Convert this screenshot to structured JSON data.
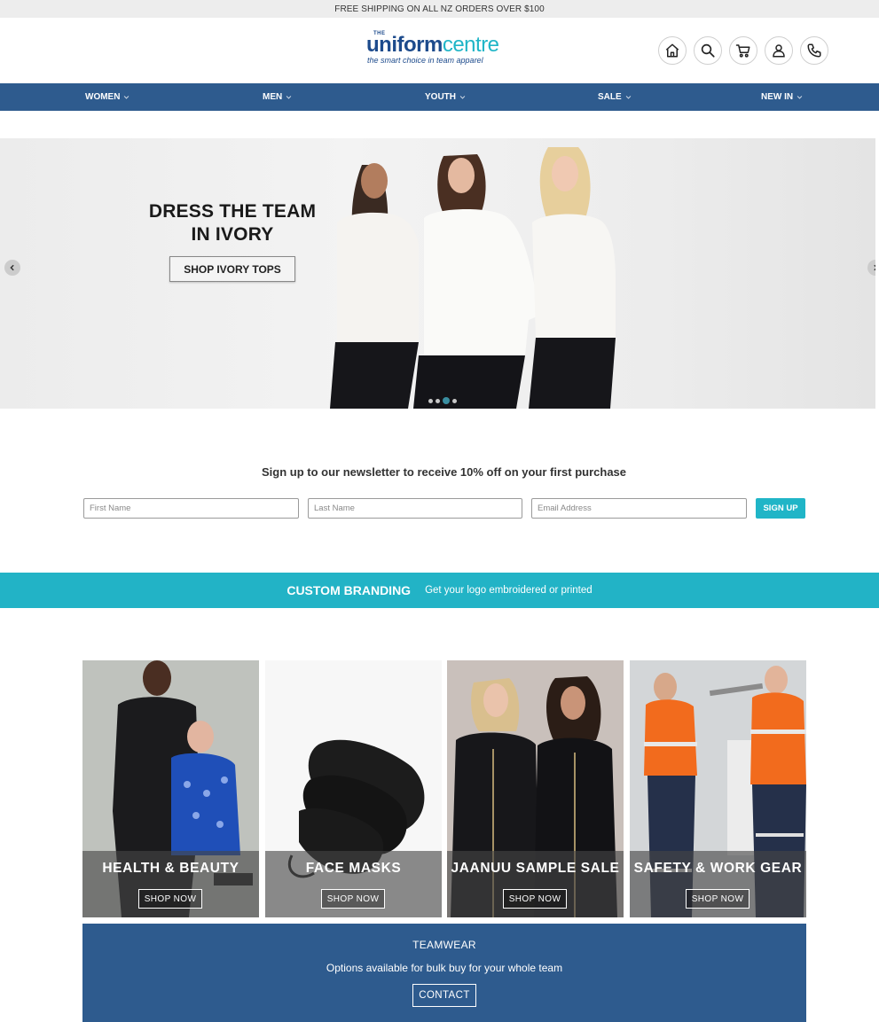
{
  "topbar": {
    "text": "FREE SHIPPING ON ALL NZ ORDERS OVER $100"
  },
  "logo": {
    "the": "THE",
    "brand_bold": "uniform",
    "brand_light": "centre",
    "tagline": "the smart choice in team apparel"
  },
  "header_icons": [
    "home-icon",
    "search-icon",
    "cart-icon",
    "user-icon",
    "phone-icon"
  ],
  "nav": [
    {
      "label": "WOMEN"
    },
    {
      "label": "MEN"
    },
    {
      "label": "YOUTH"
    },
    {
      "label": "SALE"
    },
    {
      "label": "NEW IN"
    }
  ],
  "hero": {
    "title_line1": "DRESS THE TEAM",
    "title_line2": "IN IVORY",
    "button": "SHOP IVORY TOPS",
    "slides_total": 4,
    "active_slide": 3
  },
  "newsletter": {
    "title": "Sign up to our newsletter to receive 10% off on your first purchase",
    "first_name_placeholder": "First Name",
    "last_name_placeholder": "Last Name",
    "email_placeholder": "Email Address",
    "button": "SIGN UP"
  },
  "branding": {
    "title": "CUSTOM BRANDING",
    "subtitle": "Get your logo embroidered or printed"
  },
  "tiles": [
    {
      "title": "HEALTH & BEAUTY",
      "button": "SHOP NOW"
    },
    {
      "title": "FACE MASKS",
      "button": "SHOP NOW"
    },
    {
      "title": "JAANUU SAMPLE SALE",
      "button": "SHOP NOW"
    },
    {
      "title": "SAFETY & WORK GEAR",
      "button": "SHOP NOW"
    }
  ],
  "teamwear": {
    "title": "TEAMWEAR",
    "subtitle": "Options available for bulk buy for your whole team",
    "button": "CONTACT"
  },
  "colors": {
    "navy": "#2e5b8e",
    "teal": "#22b3c6",
    "logo_blue": "#1d4b8c"
  }
}
